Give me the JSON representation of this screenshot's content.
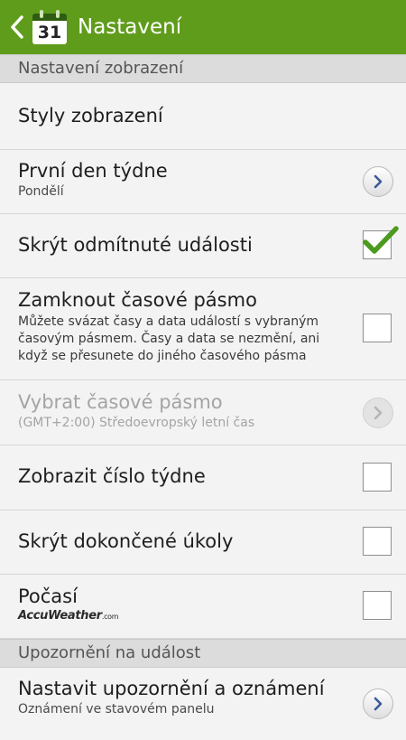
{
  "actionbar": {
    "calendar_day": "31",
    "title": "Nastavení"
  },
  "sections": {
    "display": "Nastavení zobrazení",
    "notify": "Upozornění na událost"
  },
  "rows": {
    "view_styles": {
      "title": "Styly zobrazení"
    },
    "first_day": {
      "title": "První den týdne",
      "subtitle": "Pondělí"
    },
    "hide_declined": {
      "title": "Skrýt odmítnuté události",
      "checked": true
    },
    "lock_tz": {
      "title": "Zamknout časové pásmo",
      "desc": "Můžete svázat časy a data událostí s vybraným časovým pásmem. Časy a data se nezmění, ani když se přesunete do jiného časového pásma",
      "checked": false
    },
    "select_tz": {
      "title": "Vybrat časové pásmo",
      "subtitle": "(GMT+2:00) Středoevropský letní čas",
      "enabled": false
    },
    "week_number": {
      "title": "Zobrazit číslo týdne",
      "checked": false
    },
    "hide_tasks": {
      "title": "Skrýt dokončené úkoly",
      "checked": false
    },
    "weather": {
      "title": "Počasí",
      "brand": "AccuWeather",
      "brand_suffix": ".com",
      "checked": false
    },
    "alerts": {
      "title": "Nastavit upozornění a oznámení",
      "subtitle": "Oznámení ve stavovém panelu"
    }
  },
  "colors": {
    "accent": "#5f9c1b",
    "check": "#4c9a1e"
  },
  "icons": [
    "back-arrow-icon",
    "calendar-icon",
    "chevron-right-icon",
    "checkmark-icon"
  ]
}
